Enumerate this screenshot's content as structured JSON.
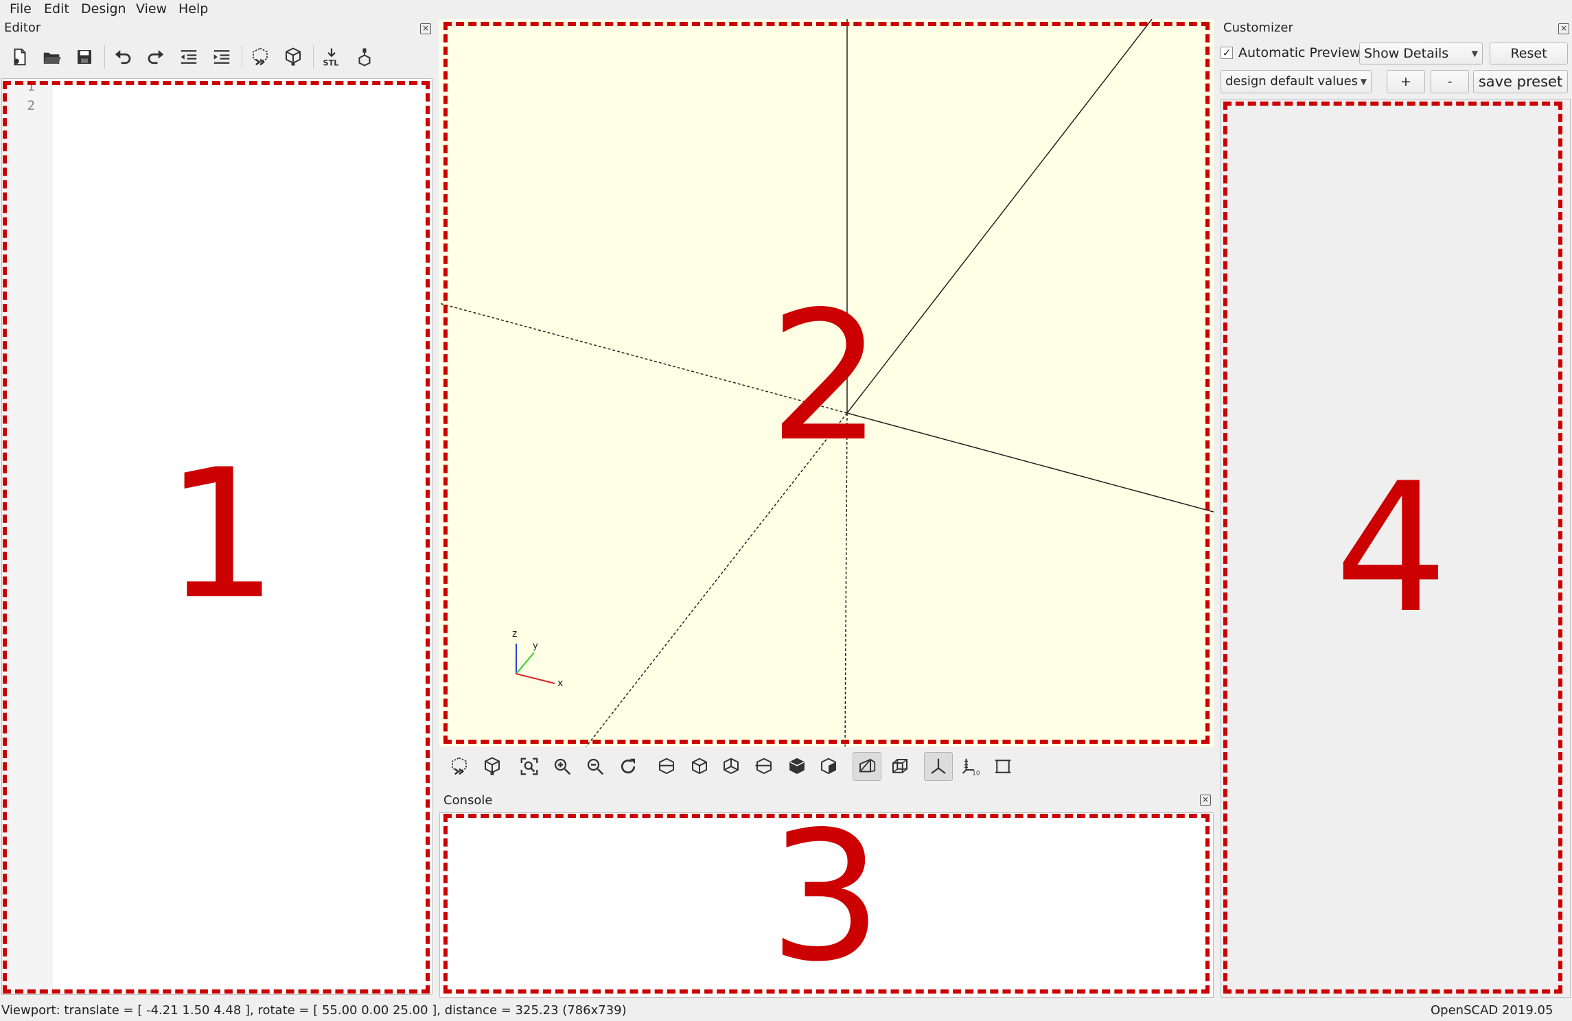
{
  "menu": {
    "file": "File",
    "edit": "Edit",
    "design": "Design",
    "view": "View",
    "help": "Help"
  },
  "editor": {
    "title": "Editor",
    "line_numbers": [
      "1",
      "2"
    ]
  },
  "customizer": {
    "title": "Customizer",
    "automatic_preview_label": "Automatic Preview",
    "automatic_preview_checked": true,
    "details_select": "Show Details",
    "reset_label": "Reset",
    "preset_select": "design default values",
    "plus_label": "+",
    "minus_label": "-",
    "save_preset_label": "save preset"
  },
  "console": {
    "title": "Console"
  },
  "axes_widget": {
    "x": "x",
    "y": "y",
    "z": "z"
  },
  "annotations": {
    "region1": "1",
    "region2": "2",
    "region3": "3",
    "region4": "4",
    "color": "#cc0000"
  },
  "statusbar": {
    "viewport_text": "Viewport: translate = [ -4.21 1.50 4.48 ], rotate = [ 55.00 0.00 25.00 ], distance = 325.23 (786x739)",
    "version": "OpenSCAD 2019.05"
  },
  "colors": {
    "viewport_bg": "#ffffe5",
    "panel_bg": "#efefef"
  }
}
